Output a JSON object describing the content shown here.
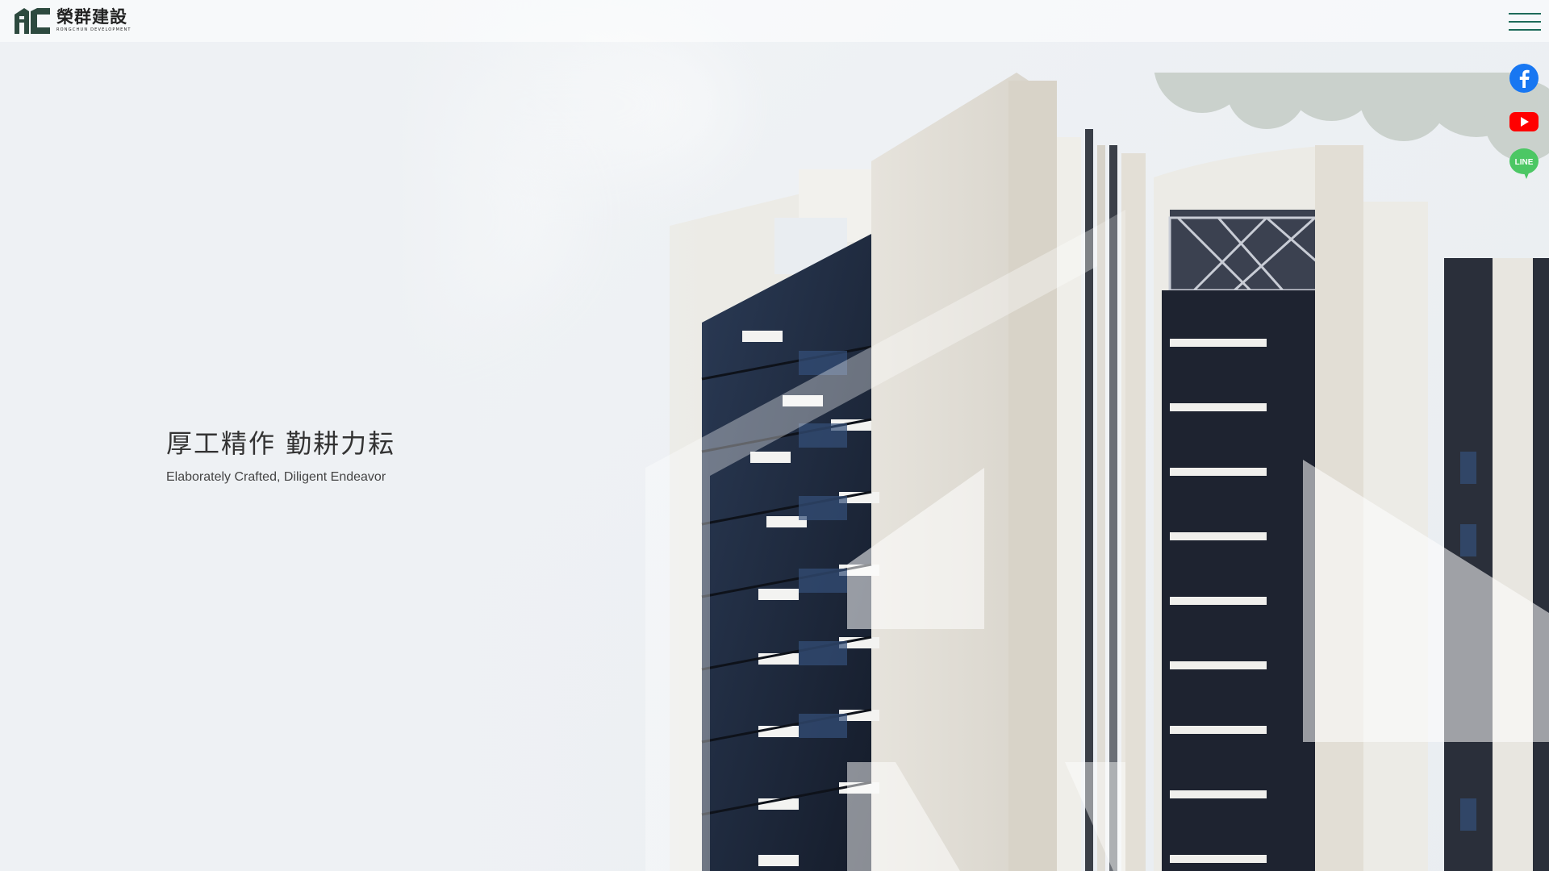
{
  "header": {
    "logo_cn": "榮群建設",
    "logo_en": "RONGCHUN DEVELOPMENT",
    "menu_icon": "hamburger-menu-icon"
  },
  "social": [
    {
      "name": "facebook",
      "icon": "facebook-icon",
      "color": "#1877f2"
    },
    {
      "name": "youtube",
      "icon": "youtube-icon",
      "color": "#ff0000"
    },
    {
      "name": "line",
      "icon": "line-icon",
      "color": "#4cc764"
    }
  ],
  "hero": {
    "title_cn": "厚工精作 勤耕力耘",
    "subtitle_en": "Elaborately Crafted, Diligent Endeavor"
  },
  "colors": {
    "brand_green": "#1e6b5a",
    "logo_dark": "#2d4a3f"
  }
}
